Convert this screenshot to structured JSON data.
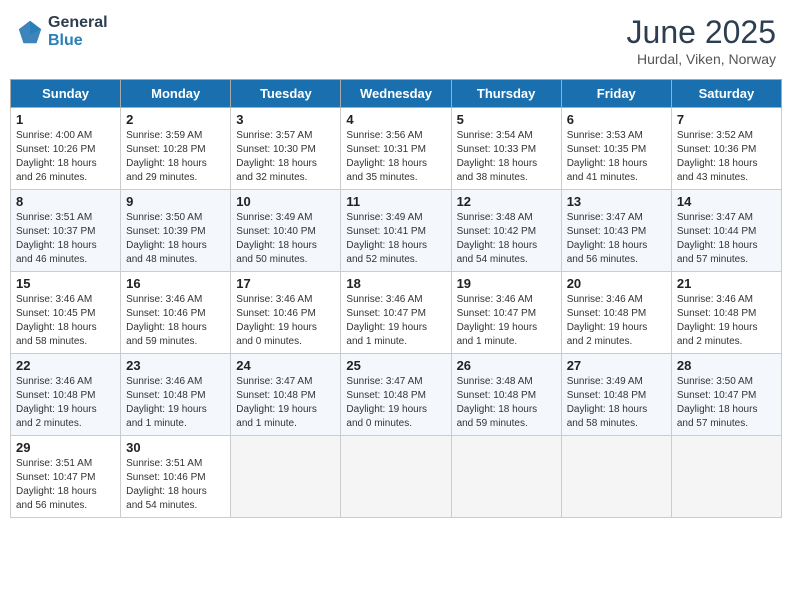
{
  "logo": {
    "general": "General",
    "blue": "Blue"
  },
  "title": "June 2025",
  "subtitle": "Hurdal, Viken, Norway",
  "days": [
    "Sunday",
    "Monday",
    "Tuesday",
    "Wednesday",
    "Thursday",
    "Friday",
    "Saturday"
  ],
  "weeks": [
    [
      {
        "day": "1",
        "sunrise": "4:00 AM",
        "sunset": "10:26 PM",
        "daylight": "18 hours and 26 minutes."
      },
      {
        "day": "2",
        "sunrise": "3:59 AM",
        "sunset": "10:28 PM",
        "daylight": "18 hours and 29 minutes."
      },
      {
        "day": "3",
        "sunrise": "3:57 AM",
        "sunset": "10:30 PM",
        "daylight": "18 hours and 32 minutes."
      },
      {
        "day": "4",
        "sunrise": "3:56 AM",
        "sunset": "10:31 PM",
        "daylight": "18 hours and 35 minutes."
      },
      {
        "day": "5",
        "sunrise": "3:54 AM",
        "sunset": "10:33 PM",
        "daylight": "18 hours and 38 minutes."
      },
      {
        "day": "6",
        "sunrise": "3:53 AM",
        "sunset": "10:35 PM",
        "daylight": "18 hours and 41 minutes."
      },
      {
        "day": "7",
        "sunrise": "3:52 AM",
        "sunset": "10:36 PM",
        "daylight": "18 hours and 43 minutes."
      }
    ],
    [
      {
        "day": "8",
        "sunrise": "3:51 AM",
        "sunset": "10:37 PM",
        "daylight": "18 hours and 46 minutes."
      },
      {
        "day": "9",
        "sunrise": "3:50 AM",
        "sunset": "10:39 PM",
        "daylight": "18 hours and 48 minutes."
      },
      {
        "day": "10",
        "sunrise": "3:49 AM",
        "sunset": "10:40 PM",
        "daylight": "18 hours and 50 minutes."
      },
      {
        "day": "11",
        "sunrise": "3:49 AM",
        "sunset": "10:41 PM",
        "daylight": "18 hours and 52 minutes."
      },
      {
        "day": "12",
        "sunrise": "3:48 AM",
        "sunset": "10:42 PM",
        "daylight": "18 hours and 54 minutes."
      },
      {
        "day": "13",
        "sunrise": "3:47 AM",
        "sunset": "10:43 PM",
        "daylight": "18 hours and 56 minutes."
      },
      {
        "day": "14",
        "sunrise": "3:47 AM",
        "sunset": "10:44 PM",
        "daylight": "18 hours and 57 minutes."
      }
    ],
    [
      {
        "day": "15",
        "sunrise": "3:46 AM",
        "sunset": "10:45 PM",
        "daylight": "18 hours and 58 minutes."
      },
      {
        "day": "16",
        "sunrise": "3:46 AM",
        "sunset": "10:46 PM",
        "daylight": "18 hours and 59 minutes."
      },
      {
        "day": "17",
        "sunrise": "3:46 AM",
        "sunset": "10:46 PM",
        "daylight": "19 hours and 0 minutes."
      },
      {
        "day": "18",
        "sunrise": "3:46 AM",
        "sunset": "10:47 PM",
        "daylight": "19 hours and 1 minute."
      },
      {
        "day": "19",
        "sunrise": "3:46 AM",
        "sunset": "10:47 PM",
        "daylight": "19 hours and 1 minute."
      },
      {
        "day": "20",
        "sunrise": "3:46 AM",
        "sunset": "10:48 PM",
        "daylight": "19 hours and 2 minutes."
      },
      {
        "day": "21",
        "sunrise": "3:46 AM",
        "sunset": "10:48 PM",
        "daylight": "19 hours and 2 minutes."
      }
    ],
    [
      {
        "day": "22",
        "sunrise": "3:46 AM",
        "sunset": "10:48 PM",
        "daylight": "19 hours and 2 minutes."
      },
      {
        "day": "23",
        "sunrise": "3:46 AM",
        "sunset": "10:48 PM",
        "daylight": "19 hours and 1 minute."
      },
      {
        "day": "24",
        "sunrise": "3:47 AM",
        "sunset": "10:48 PM",
        "daylight": "19 hours and 1 minute."
      },
      {
        "day": "25",
        "sunrise": "3:47 AM",
        "sunset": "10:48 PM",
        "daylight": "19 hours and 0 minutes."
      },
      {
        "day": "26",
        "sunrise": "3:48 AM",
        "sunset": "10:48 PM",
        "daylight": "18 hours and 59 minutes."
      },
      {
        "day": "27",
        "sunrise": "3:49 AM",
        "sunset": "10:48 PM",
        "daylight": "18 hours and 58 minutes."
      },
      {
        "day": "28",
        "sunrise": "3:50 AM",
        "sunset": "10:47 PM",
        "daylight": "18 hours and 57 minutes."
      }
    ],
    [
      {
        "day": "29",
        "sunrise": "3:51 AM",
        "sunset": "10:47 PM",
        "daylight": "18 hours and 56 minutes."
      },
      {
        "day": "30",
        "sunrise": "3:51 AM",
        "sunset": "10:46 PM",
        "daylight": "18 hours and 54 minutes."
      },
      {
        "day": "",
        "sunrise": "",
        "sunset": "",
        "daylight": ""
      },
      {
        "day": "",
        "sunrise": "",
        "sunset": "",
        "daylight": ""
      },
      {
        "day": "",
        "sunrise": "",
        "sunset": "",
        "daylight": ""
      },
      {
        "day": "",
        "sunrise": "",
        "sunset": "",
        "daylight": ""
      },
      {
        "day": "",
        "sunrise": "",
        "sunset": "",
        "daylight": ""
      }
    ]
  ]
}
